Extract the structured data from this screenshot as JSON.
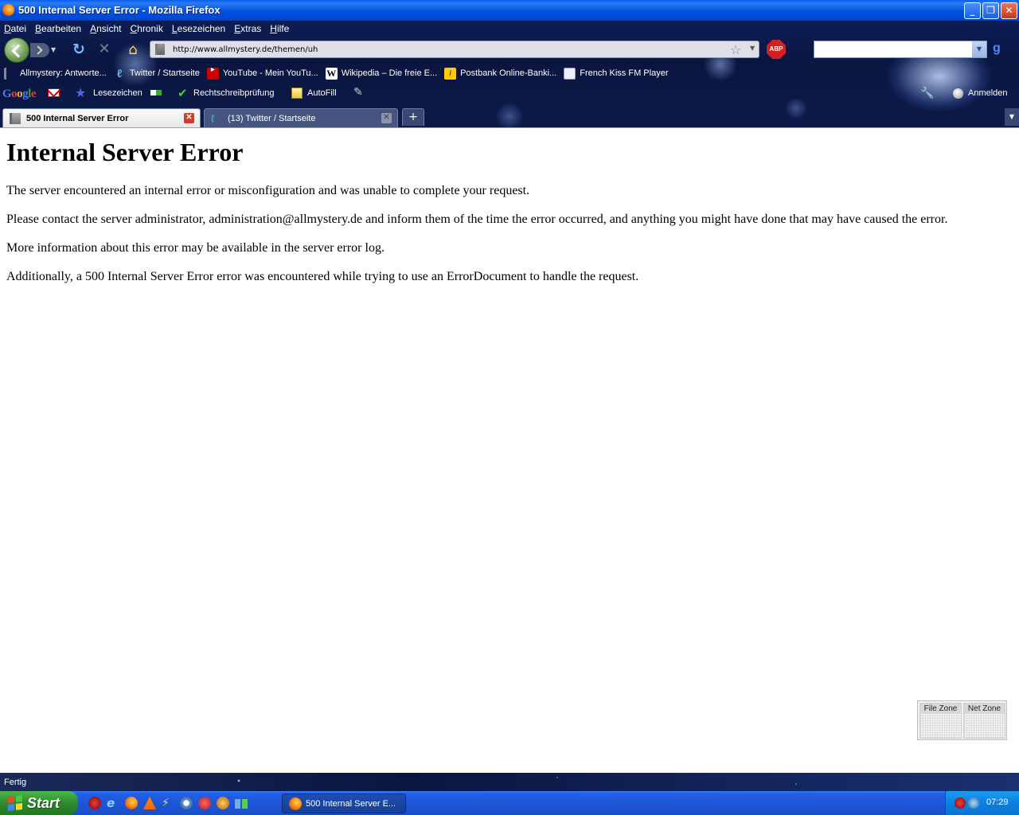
{
  "window": {
    "title": "500 Internal Server Error - Mozilla Firefox",
    "min_label": "_",
    "max_label": "❐",
    "close_label": "✕"
  },
  "menubar": {
    "items": [
      {
        "label": "Datei",
        "accel": "D",
        "rest": "atei"
      },
      {
        "label": "Bearbeiten",
        "accel": "B",
        "rest": "earbeiten"
      },
      {
        "label": "Ansicht",
        "accel": "A",
        "rest": "nsicht"
      },
      {
        "label": "Chronik",
        "accel": "C",
        "rest": "hronik"
      },
      {
        "label": "Lesezeichen",
        "accel": "L",
        "rest": "esezeichen"
      },
      {
        "label": "Extras",
        "accel": "E",
        "rest": "xtras"
      },
      {
        "label": "Hilfe",
        "accel": "H",
        "rest": "ilfe"
      }
    ]
  },
  "navbar": {
    "url": "http://www.allmystery.de/themen/uh",
    "search_value": ""
  },
  "bookmarks": [
    {
      "label": "Allmystery: Antworte...",
      "icon": "site-icon"
    },
    {
      "label": "Twitter / Startseite",
      "icon": "twitter-icon"
    },
    {
      "label": "YouTube - Mein YouTu...",
      "icon": "youtube-icon"
    },
    {
      "label": "Wikipedia – Die freie E...",
      "icon": "wikipedia-icon"
    },
    {
      "label": "Postbank Online-Banki...",
      "icon": "postbank-icon"
    },
    {
      "label": "French Kiss FM Player",
      "icon": "page-icon"
    }
  ],
  "google_toolbar": {
    "bookmarks_label": "Lesezeichen",
    "spellcheck_label": "Rechtschreibprüfung",
    "autofill_label": "AutoFill",
    "signin_label": "Anmelden"
  },
  "tabs": [
    {
      "label": "500 Internal Server Error",
      "active": true
    },
    {
      "label": "(13) Twitter / Startseite",
      "active": false
    }
  ],
  "page": {
    "heading": "Internal Server Error",
    "paragraphs": [
      "The server encountered an internal error or misconfiguration and was unable to complete your request.",
      "Please contact the server administrator, administration@allmystery.de and inform them of the time the error occurred, and anything you might have done that may have caused the error.",
      "More information about this error may be available in the server error log.",
      "Additionally, a 500 Internal Server Error error was encountered while trying to use an ErrorDocument to handle the request."
    ]
  },
  "zone_widget": {
    "file_zone": "File Zone",
    "net_zone": "Net Zone"
  },
  "statusbar": {
    "text": "Fertig"
  },
  "taskbar": {
    "start_label": "Start",
    "task_label": "500 Internal Server E...",
    "clock": "07:29"
  },
  "colors": {
    "titlebar": "#0050e0",
    "taskbar": "#1e56d8",
    "start_button": "#2d8a2d",
    "tab_close": "#d43a2a"
  }
}
